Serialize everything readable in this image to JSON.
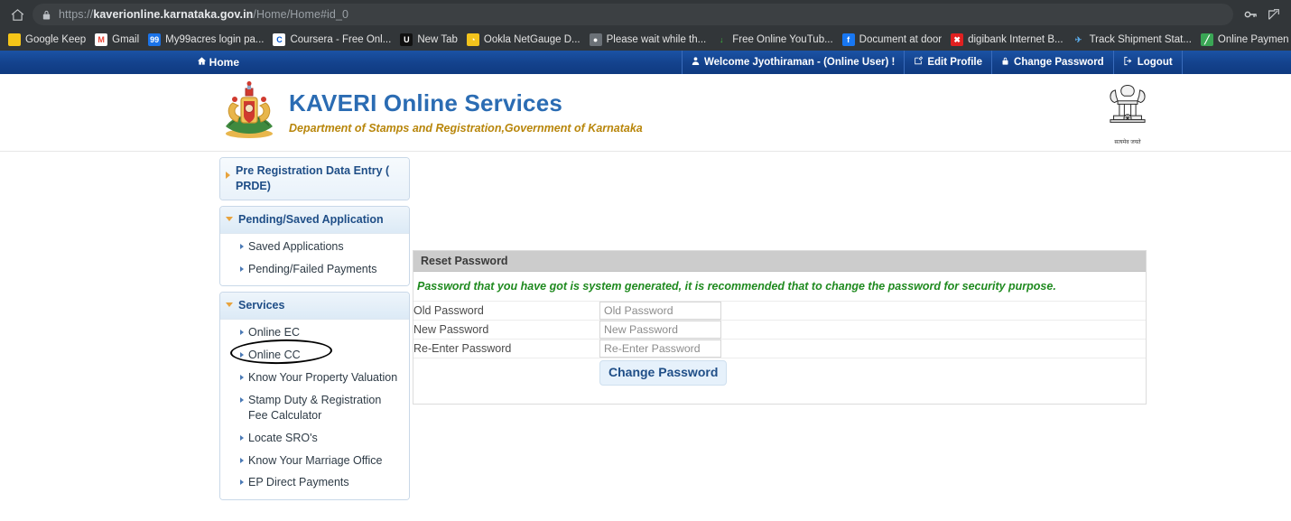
{
  "browser": {
    "url_full": "https://kaverionline.karnataka.gov.in/Home/Home#id_0",
    "url_scheme": "https://",
    "url_host": "kaverionline.karnataka.gov.in",
    "url_path": "/Home/Home#id_0",
    "home_icon": "home-icon",
    "lock_icon": "lock-icon",
    "password_key_icon": "key-icon",
    "share_icon": "share-icon",
    "bookmarks": [
      {
        "label": "Google Keep",
        "glyph": "",
        "bg": "#f5c518",
        "fg": "#ffffff"
      },
      {
        "label": "Gmail",
        "glyph": "M",
        "bg": "#ffffff",
        "fg": "#ea4335"
      },
      {
        "label": "My99acres login pa...",
        "glyph": "99",
        "bg": "#1a73e8",
        "fg": "#ffffff"
      },
      {
        "label": "Coursera - Free Onl...",
        "glyph": "C",
        "bg": "#ffffff",
        "fg": "#0056d2"
      },
      {
        "label": "New Tab",
        "glyph": "U",
        "bg": "#111111",
        "fg": "#ffffff"
      },
      {
        "label": "Ookla NetGauge D...",
        "glyph": "◔",
        "bg": "#f2c31c",
        "fg": "#ffffff"
      },
      {
        "label": "Please wait while th...",
        "glyph": "●",
        "bg": "#6b7177",
        "fg": "#ffffff"
      },
      {
        "label": "Free Online YouTub...",
        "glyph": "↓",
        "bg": "#323639",
        "fg": "#3dbf3d"
      },
      {
        "label": "Document at door",
        "glyph": "f",
        "bg": "#1877f2",
        "fg": "#ffffff"
      },
      {
        "label": "digibank Internet B...",
        "glyph": "✖",
        "bg": "#e02020",
        "fg": "#ffffff"
      },
      {
        "label": "Track Shipment Stat...",
        "glyph": "✈",
        "bg": "#323639",
        "fg": "#5aa9e6"
      },
      {
        "label": "Online Paymen",
        "glyph": "╱",
        "bg": "#3aa655",
        "fg": "#ffffff"
      }
    ]
  },
  "topnav": {
    "home_label": "Home",
    "home_icon": "home-icon",
    "items": [
      {
        "label": "Welcome Jyothiraman - (Online User) !",
        "icon": "user-icon"
      },
      {
        "label": "Edit Profile",
        "icon": "edit-icon"
      },
      {
        "label": "Change Password",
        "icon": "lock-icon"
      },
      {
        "label": "Logout",
        "icon": "logout-icon"
      }
    ]
  },
  "header": {
    "title": "KAVERI Online Services",
    "subtitle": "Department of Stamps and Registration,Government of Karnataka",
    "left_emblem": "karnataka-state-emblem",
    "right_emblem": "india-national-emblem",
    "right_emblem_caption": "सत्यमेव जयते",
    "title_color": "#2b6cb3",
    "subtitle_color": "#b8860b"
  },
  "sidebar": {
    "panels": [
      {
        "title": "Pre Registration Data Entry ( PRDE)",
        "state": "collapsed",
        "items": []
      },
      {
        "title": "Pending/Saved Application",
        "state": "expanded",
        "items": [
          {
            "label": "Saved Applications"
          },
          {
            "label": "Pending/Failed Payments"
          }
        ]
      },
      {
        "title": "Services",
        "state": "expanded",
        "items": [
          {
            "label": "Online EC"
          },
          {
            "label": "Online CC",
            "annotated": true
          },
          {
            "label": "Know Your Property Valuation"
          },
          {
            "label": "Stamp Duty & Registration Fee Calculator"
          },
          {
            "label": "Locate SRO's"
          },
          {
            "label": "Know Your Marriage Office"
          },
          {
            "label": "EP Direct Payments"
          }
        ]
      }
    ],
    "annotation": {
      "shape": "ellipse",
      "target": "Online CC",
      "color": "#000000"
    }
  },
  "main": {
    "panel_title": "Reset Password",
    "note": "Password that you have got is system generated, it is recommended that to change the password for security purpose.",
    "note_color": "#1f8a1f",
    "fields": [
      {
        "label": "Old Password",
        "value": "",
        "placeholder": "Old Password"
      },
      {
        "label": "New Password",
        "value": "",
        "placeholder": "New Password"
      },
      {
        "label": "Re-Enter Password",
        "value": "",
        "placeholder": "Re-Enter Password"
      }
    ],
    "submit_label": "Change Password"
  }
}
